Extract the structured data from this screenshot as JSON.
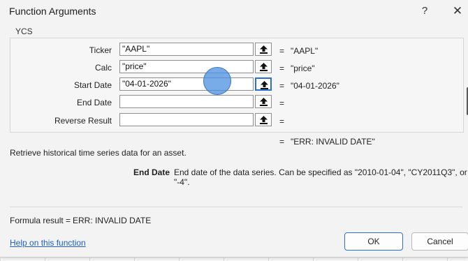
{
  "dialog": {
    "title": "Function Arguments",
    "help_glyph": "?",
    "close_glyph": "✕"
  },
  "function_name": "YCS",
  "arguments": [
    {
      "label": "Ticker",
      "value": "\"AAPL\"",
      "result": "\"AAPL\""
    },
    {
      "label": "Calc",
      "value": "\"price\"",
      "result": "\"price\""
    },
    {
      "label": "Start Date",
      "value": "\"04-01-2026\"",
      "result": "\"04-01-2026\""
    },
    {
      "label": "End Date",
      "value": "",
      "result": ""
    },
    {
      "label": "Reverse Result",
      "value": "",
      "result": ""
    }
  ],
  "equals": "=",
  "overall_result": "\"ERR: INVALID DATE\"",
  "function_description": "Retrieve historical time series data for an asset.",
  "argument_help": {
    "name": "End Date",
    "text": "End date of the data series. Can be specified as \"2010-01-04\", \"CY2011Q3\", or \"-4\"."
  },
  "formula_result": {
    "label": "Formula result =",
    "value": "ERR: INVALID DATE"
  },
  "help_link": "Help on this function",
  "buttons": {
    "ok": "OK",
    "cancel": "Cancel"
  },
  "icons": {
    "collapse": "upload-arrow-icon"
  }
}
